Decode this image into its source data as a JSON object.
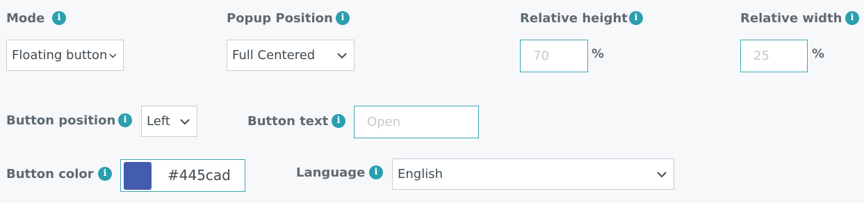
{
  "mode": {
    "label": "Mode",
    "value": "Floating button"
  },
  "popup_position": {
    "label": "Popup Position",
    "value": "Full Centered"
  },
  "relative_height": {
    "label": "Relative height",
    "placeholder": "70",
    "unit": "%"
  },
  "relative_width": {
    "label": "Relative width",
    "placeholder": "25",
    "unit": "%"
  },
  "button_position": {
    "label": "Button position",
    "value": "Left"
  },
  "button_text": {
    "label": "Button text",
    "placeholder": "Open"
  },
  "button_color": {
    "label": "Button color",
    "value": "#445cad",
    "swatch_color": "#445cad"
  },
  "language": {
    "label": "Language",
    "value": "English"
  },
  "info_glyph": "i",
  "colors": {
    "accent": "#2a9fb0",
    "label": "#5e6a72",
    "background": "#f7f8fa"
  }
}
